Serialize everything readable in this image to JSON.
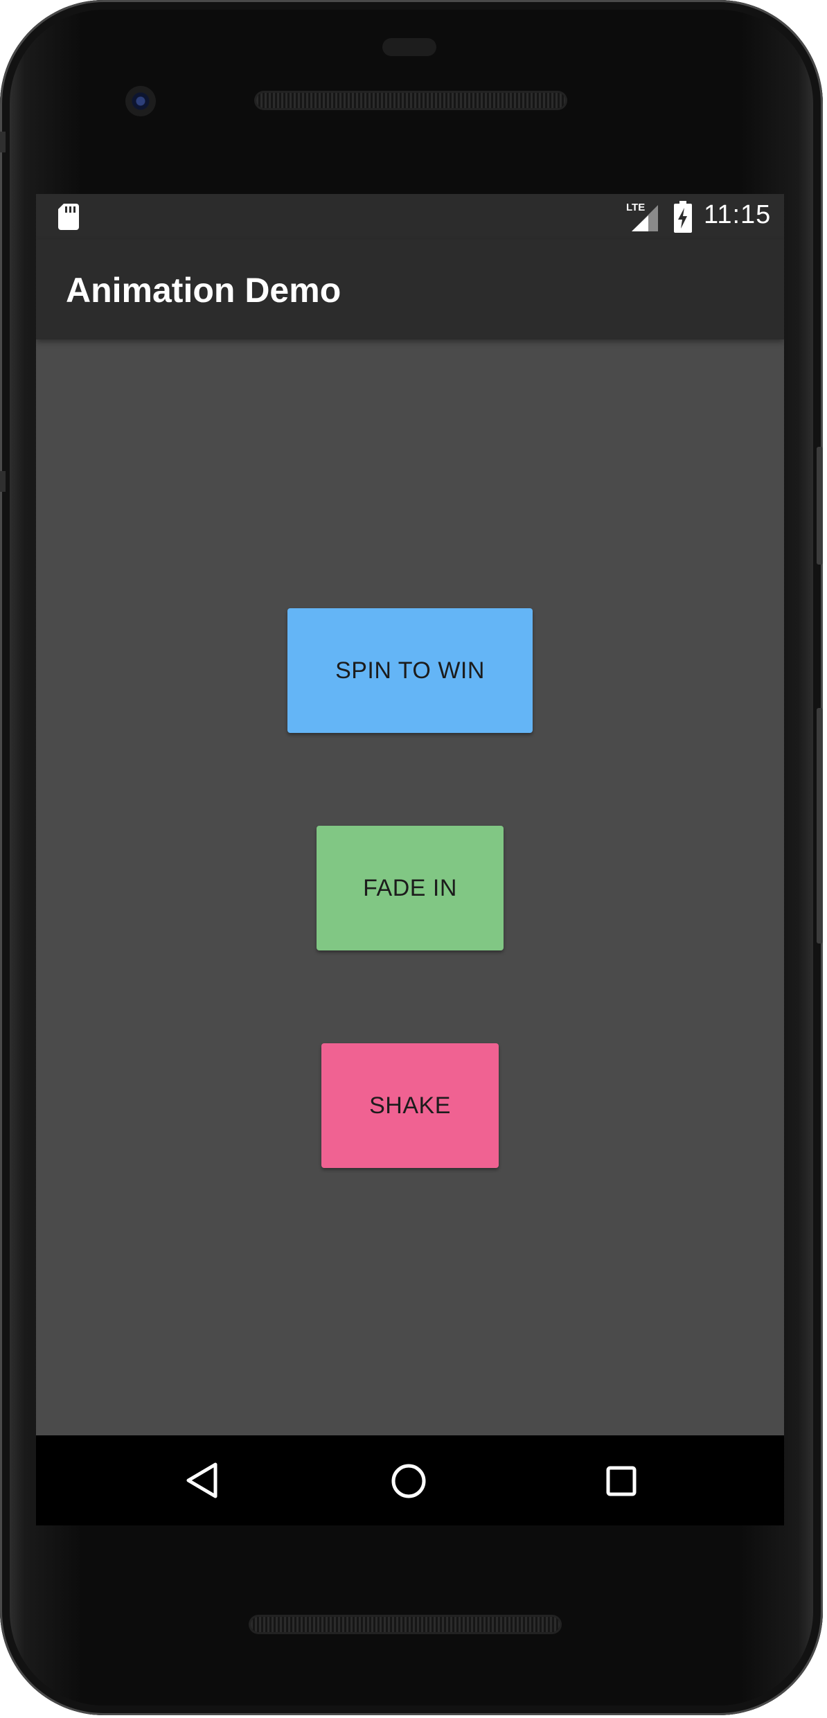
{
  "status_bar": {
    "time": "11:15",
    "icons": [
      "sd-card-icon",
      "lte-signal-icon",
      "battery-charging-icon"
    ],
    "network_label": "LTE"
  },
  "app_bar": {
    "title": "Animation Demo",
    "background": "#2c2c2c"
  },
  "content": {
    "background": "#4b4b4b",
    "buttons": [
      {
        "label": "SPIN TO WIN",
        "color": "#64b5f6"
      },
      {
        "label": "FADE IN",
        "color": "#81c784"
      },
      {
        "label": "SHAKE",
        "color": "#f06292"
      }
    ]
  },
  "nav_bar": {
    "icons": [
      "back-icon",
      "home-icon",
      "recents-icon"
    ]
  }
}
